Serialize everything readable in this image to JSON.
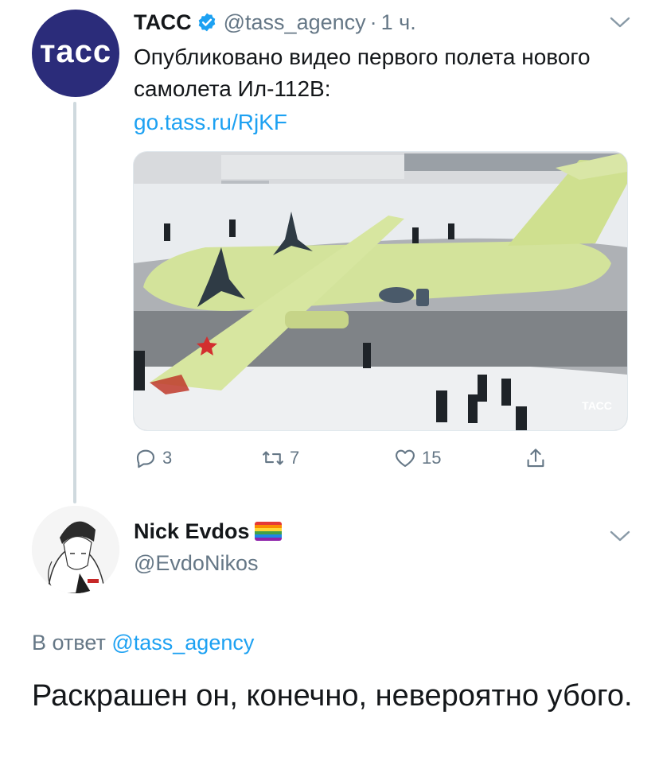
{
  "parent_tweet": {
    "display_name": "ТАСС",
    "handle": "@tass_agency",
    "separator": "·",
    "time": "1 ч.",
    "avatar_text": "тасс",
    "text": "Опубликовано видео первого полета нового самолета Ил-112В:",
    "link": "go.tass.ru/RjKF",
    "media_watermark": "ТАСС",
    "counts": {
      "replies": "3",
      "retweets": "7",
      "likes": "15"
    },
    "icons": {
      "reply": "reply-icon",
      "retweet": "retweet-icon",
      "like": "heart-icon",
      "share": "share-icon",
      "more": "chevron-down-icon",
      "verified": "verified-badge-icon"
    }
  },
  "reply_tweet": {
    "display_name": "Nick Evdos",
    "handle": "@EvdoNikos",
    "reply_prefix": "В ответ",
    "reply_mention": "@tass_agency",
    "text": "Раскрашен он, конечно, невероятно убого.",
    "flag_emoji": "rainbow-flag"
  },
  "colors": {
    "accent": "#1da1f2",
    "secondary_text": "#657786",
    "primary_text": "#14171a",
    "tass_brand": "#2b2c7a",
    "thread_line": "#cfd9de"
  }
}
